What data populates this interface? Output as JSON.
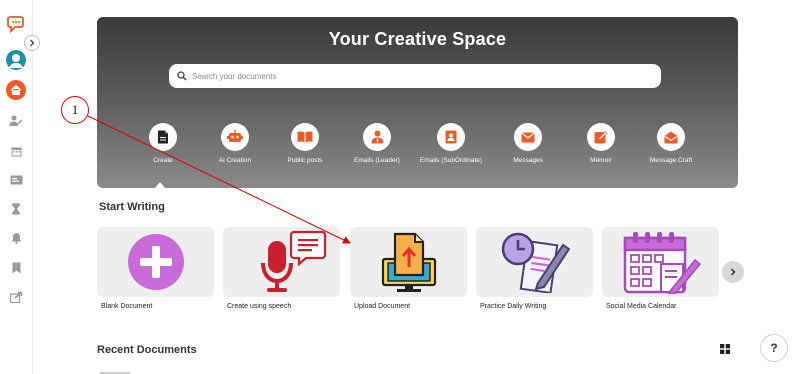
{
  "colors": {
    "brand": "#f05a28",
    "accent_purple": "#c86ad8",
    "annotation": "#e00000"
  },
  "sidebar": {
    "items": [
      {
        "icon": "chat-logo-icon"
      },
      {
        "icon": "avatar-icon"
      },
      {
        "icon": "home-icon"
      },
      {
        "icon": "user-edit-icon"
      },
      {
        "icon": "calendar-icon"
      },
      {
        "icon": "id-card-icon"
      },
      {
        "icon": "hourglass-icon"
      },
      {
        "icon": "bell-icon"
      },
      {
        "icon": "bookmark-icon"
      },
      {
        "icon": "share-icon"
      }
    ]
  },
  "hero": {
    "title": "Your Creative Space",
    "search_placeholder": "Search your documents",
    "categories": [
      {
        "label": "Create",
        "icon": "document-icon",
        "selected": true
      },
      {
        "label": "Ai Creation",
        "icon": "robot-icon"
      },
      {
        "label": "Public posts",
        "icon": "book-icon"
      },
      {
        "label": "Emails (Leader)",
        "icon": "leader-icon"
      },
      {
        "label": "Emails (SubOrdinate)",
        "icon": "contact-icon"
      },
      {
        "label": "Messages",
        "icon": "mail-icon"
      },
      {
        "label": "Memoir",
        "icon": "pencil-square-icon"
      },
      {
        "label": "Message Craft",
        "icon": "envelope-open-icon"
      }
    ]
  },
  "start_writing": {
    "title": "Start Writing",
    "cards": [
      {
        "label": "Blank Document",
        "icon": "plus-circle-icon"
      },
      {
        "label": "Create using speech",
        "icon": "microphone-icon"
      },
      {
        "label": "Upload Document",
        "icon": "upload-monitor-icon"
      },
      {
        "label": "Practice Daily Writing",
        "icon": "clock-notepad-icon"
      },
      {
        "label": "Social Media Calendar",
        "icon": "calendar-edit-icon"
      }
    ]
  },
  "recent": {
    "title": "Recent Documents"
  },
  "help": {
    "label": "?"
  },
  "annotation": {
    "number": "1"
  }
}
